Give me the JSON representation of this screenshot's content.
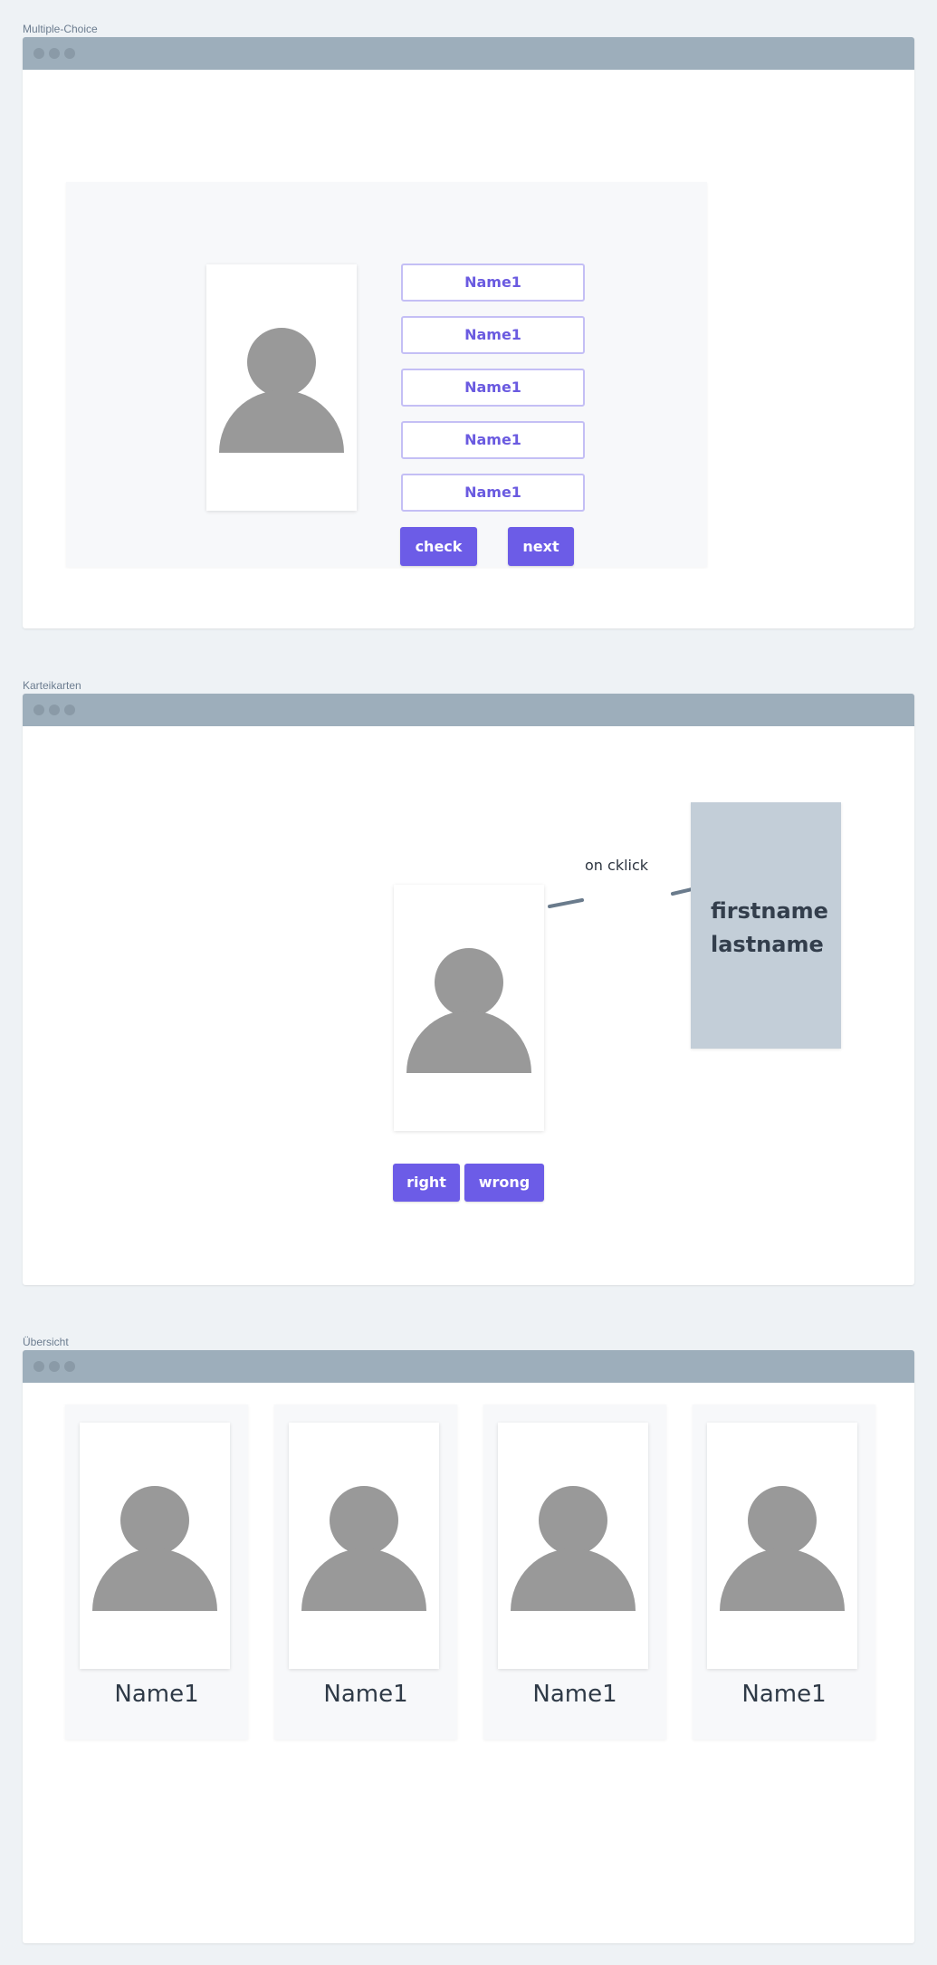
{
  "frames": {
    "multiple_choice": {
      "label": "Multiple-Choice"
    },
    "karteikarten": {
      "label": "Karteikarten"
    },
    "uebersicht": {
      "label": "Übersicht"
    }
  },
  "multiple_choice": {
    "options": [
      "Name1",
      "Name1",
      "Name1",
      "Name1",
      "Name1"
    ],
    "check_label": "check",
    "next_label": "next"
  },
  "karteikarten": {
    "flip_firstname": "firstname",
    "flip_lastname": "lastname",
    "arrow_label": "on cklick",
    "right_label": "right",
    "wrong_label": "wrong"
  },
  "uebersicht": {
    "cards": [
      {
        "name": "Name1"
      },
      {
        "name": "Name1"
      },
      {
        "name": "Name1"
      },
      {
        "name": "Name1"
      }
    ]
  },
  "icons": {
    "avatar": "person-avatar-icon",
    "window_dots": "window-control-dots"
  },
  "colors": {
    "accent": "#6c5ce7",
    "titlebar": "#9daebb",
    "flip_card": "#c3ced8",
    "avatar": "#999999"
  }
}
